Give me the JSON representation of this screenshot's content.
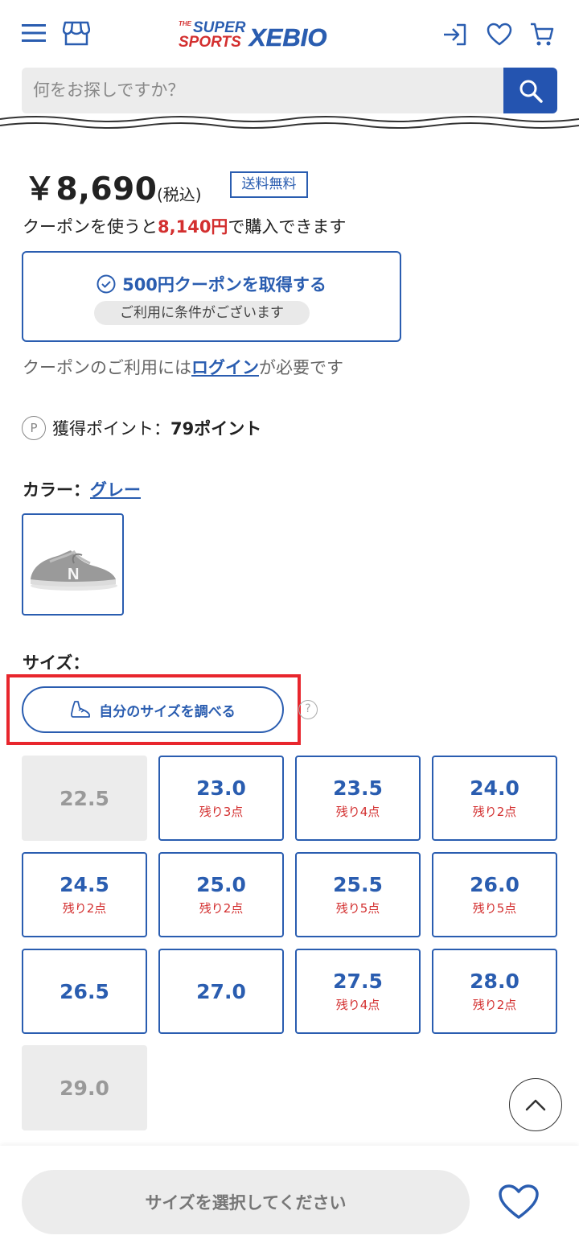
{
  "header": {
    "logo_super": "SUPER",
    "logo_sports": "SPORTS",
    "logo_xebio": "XEBIO",
    "logo_the": "THE",
    "search_placeholder": "何をお探しですか？"
  },
  "product": {
    "price": "￥8,690",
    "tax_label": "(税込)",
    "free_shipping": "送料無料",
    "coupon_line_prefix": "クーポンを使うと",
    "coupon_price": "8,140円",
    "coupon_line_suffix": "で購入できます",
    "coupon_button_label": "500円クーポンを取得する",
    "coupon_condition": "ご利用に条件がございます",
    "login_note_prefix": "クーポンのご利用には",
    "login_link": "ログイン",
    "login_note_suffix": "が必要です",
    "points_icon": "P",
    "points_label": "獲得ポイント：",
    "points_value": "79ポイント",
    "color_label": "カラー：",
    "color_value": "グレー",
    "size_label": "サイズ：",
    "size_guide_label": "自分のサイズを調べる",
    "help_icon": "?"
  },
  "sizes": [
    {
      "num": "22.5",
      "stock": "",
      "available": false
    },
    {
      "num": "23.0",
      "stock": "残り3点",
      "available": true
    },
    {
      "num": "23.5",
      "stock": "残り4点",
      "available": true
    },
    {
      "num": "24.0",
      "stock": "残り2点",
      "available": true
    },
    {
      "num": "24.5",
      "stock": "残り2点",
      "available": true
    },
    {
      "num": "25.0",
      "stock": "残り2点",
      "available": true
    },
    {
      "num": "25.5",
      "stock": "残り5点",
      "available": true
    },
    {
      "num": "26.0",
      "stock": "残り5点",
      "available": true
    },
    {
      "num": "26.5",
      "stock": "",
      "available": true
    },
    {
      "num": "27.0",
      "stock": "",
      "available": true
    },
    {
      "num": "27.5",
      "stock": "残り4点",
      "available": true
    },
    {
      "num": "28.0",
      "stock": "残り2点",
      "available": true
    },
    {
      "num": "29.0",
      "stock": "",
      "available": false
    }
  ],
  "bottom": {
    "select_size_label": "サイズを選択してください"
  },
  "colors": {
    "brand_blue": "#2a5db0",
    "search_blue": "#2454b0",
    "red": "#d32f2f",
    "highlight_red": "#e8262d"
  },
  "icons": [
    "menu-icon",
    "store-icon",
    "login-icon",
    "heart-icon",
    "cart-icon",
    "search-icon",
    "check-circle-icon",
    "point-icon",
    "shoe-icon",
    "help-icon",
    "chevron-up-icon"
  ]
}
